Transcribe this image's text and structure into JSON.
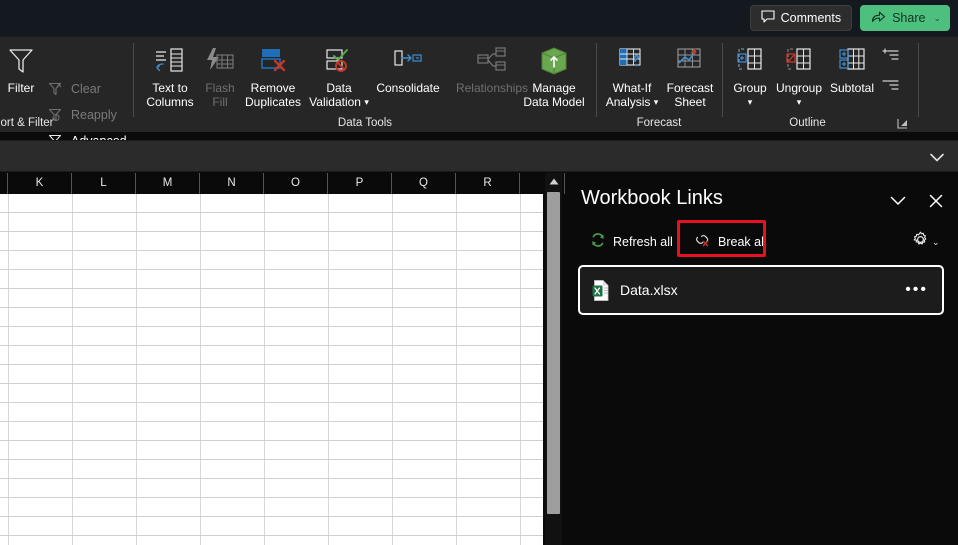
{
  "titlebar": {
    "comments_label": "Comments",
    "comments_icon": "comment-icon",
    "share_label": "Share",
    "share_icon": "share-icon",
    "share_caret": "⌄",
    "share_color": "#4ec07e"
  },
  "ribbon": {
    "collapse_icon": "chevron-down-icon",
    "groups": [
      {
        "name": "sort-and-filter",
        "label": "ort & Filter",
        "items": [
          {
            "name": "filter-button",
            "label": "Filter",
            "icon": "funnel-icon",
            "enabled": true,
            "style": "big"
          },
          {
            "name": "clear-button",
            "label": "Clear",
            "icon": "funnel-clear-icon",
            "enabled": false,
            "style": "small"
          },
          {
            "name": "reapply-button",
            "label": "Reapply",
            "icon": "funnel-reapply-icon",
            "enabled": false,
            "style": "small"
          },
          {
            "name": "advanced-button",
            "label": "Advanced",
            "icon": "funnel-advanced-icon",
            "enabled": true,
            "style": "small"
          }
        ]
      },
      {
        "name": "data-tools",
        "label": "Data Tools",
        "items": [
          {
            "name": "text-to-columns-button",
            "label": "Text to\nColumns",
            "label1": "Text to",
            "label2": "Columns",
            "icon": "text-to-columns-icon",
            "enabled": true,
            "style": "big"
          },
          {
            "name": "flash-fill-button",
            "label": "Flash\nFill",
            "label1": "Flash",
            "label2": "Fill",
            "icon": "flash-fill-icon",
            "enabled": false,
            "style": "big"
          },
          {
            "name": "remove-duplicates-button",
            "label": "Remove\nDuplicates",
            "label1": "Remove",
            "label2": "Duplicates",
            "icon": "remove-duplicates-icon",
            "enabled": true,
            "style": "big"
          },
          {
            "name": "data-validation-button",
            "label": "Data\nValidation",
            "label1": "Data",
            "label2": "Validation",
            "icon": "data-validation-icon",
            "enabled": true,
            "style": "big",
            "has_caret": true
          },
          {
            "name": "consolidate-button",
            "label": "Consolidate",
            "label1": "Consolidate",
            "label2": "",
            "icon": "consolidate-icon",
            "enabled": true,
            "style": "big"
          },
          {
            "name": "relationships-button",
            "label": "Relationships",
            "label1": "Relationships",
            "label2": "",
            "icon": "relationships-icon",
            "enabled": false,
            "style": "big"
          },
          {
            "name": "manage-data-model-button",
            "label": "Manage\nData Model",
            "label1": "Manage",
            "label2": "Data Model",
            "icon": "data-model-icon",
            "enabled": true,
            "style": "big"
          }
        ]
      },
      {
        "name": "forecast",
        "label": "Forecast",
        "items": [
          {
            "name": "what-if-analysis-button",
            "label1": "What-If",
            "label2": "Analysis",
            "icon": "what-if-icon",
            "enabled": true,
            "style": "big",
            "has_caret": true
          },
          {
            "name": "forecast-sheet-button",
            "label1": "Forecast",
            "label2": "Sheet",
            "icon": "forecast-sheet-icon",
            "enabled": true,
            "style": "big"
          }
        ]
      },
      {
        "name": "outline",
        "label": "Outline",
        "items": [
          {
            "name": "group-button",
            "label1": "Group",
            "label2": "",
            "icon": "group-icon",
            "enabled": true,
            "style": "big",
            "has_caret": true
          },
          {
            "name": "ungroup-button",
            "label1": "Ungroup",
            "label2": "",
            "icon": "ungroup-icon",
            "enabled": true,
            "style": "big",
            "has_caret": true
          },
          {
            "name": "subtotal-button",
            "label1": "Subtotal",
            "label2": "",
            "icon": "subtotal-icon",
            "enabled": true,
            "style": "big"
          },
          {
            "name": "show-detail-button",
            "label1": "",
            "label2": "",
            "icon": "show-detail-icon",
            "enabled": true,
            "style": "tiny"
          },
          {
            "name": "hide-detail-button",
            "label1": "",
            "label2": "",
            "icon": "hide-detail-icon",
            "enabled": true,
            "style": "tiny"
          }
        ],
        "dialog_launcher_icon": "dialog-launcher-icon"
      }
    ]
  },
  "formula_bar": {
    "value": "",
    "expand_icon": "chevron-down-icon"
  },
  "grid": {
    "columns": [
      "K",
      "L",
      "M",
      "N",
      "O",
      "P",
      "Q",
      "R"
    ],
    "scrollbar": {
      "up_icon": "triangle-up-icon"
    }
  },
  "workbook_links": {
    "title": "Workbook Links",
    "collapse_icon": "chevron-down-icon",
    "close_icon": "close-icon",
    "refresh_all_label": "Refresh all",
    "refresh_all_icon": "refresh-icon",
    "break_all_label": "Break all",
    "break_all_icon": "break-link-icon",
    "settings_icon": "gear-icon",
    "settings_caret": "⌄",
    "highlight_color": "#e81123",
    "links": [
      {
        "name": "Data.xlsx",
        "icon": "excel-file-icon",
        "more_label": "•••",
        "selected": true
      }
    ]
  }
}
